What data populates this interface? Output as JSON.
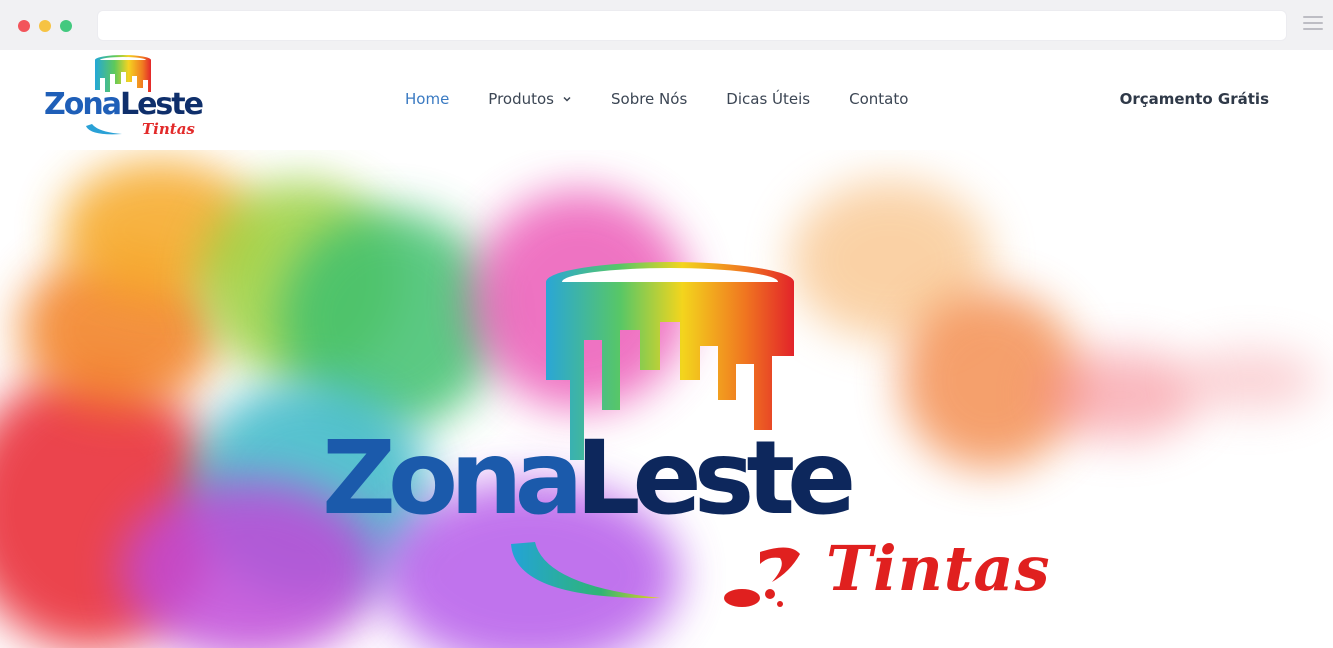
{
  "browser": {
    "address": ""
  },
  "brand": {
    "name_part1": "Zona",
    "name_part2": "Leste",
    "tagline": "Tintas",
    "colors": {
      "primary_blue": "#1f5fb8",
      "dark_navy": "#0f2f6b",
      "accent_red": "#e22a2a",
      "nav_active": "#3a7ac2"
    }
  },
  "nav": {
    "items": [
      {
        "label": "Home",
        "active": true
      },
      {
        "label": "Produtos",
        "has_dropdown": true
      },
      {
        "label": "Sobre Nós"
      },
      {
        "label": "Dicas Úteis"
      },
      {
        "label": "Contato"
      }
    ],
    "cta_label": "Orçamento Grátis"
  },
  "hero": {
    "wordmark_part1": "Zona",
    "wordmark_part2": "Leste",
    "wordmark_tagline": "Tintas"
  },
  "icons": [
    "paint-can-logo-icon",
    "chevron-down-icon",
    "menu-icon"
  ]
}
